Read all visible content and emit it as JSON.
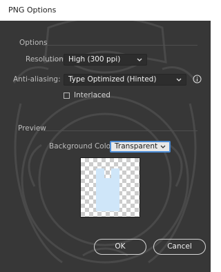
{
  "window": {
    "title": "PNG Options"
  },
  "options": {
    "group_label": "Options",
    "resolution": {
      "label": "Resolution:",
      "value": "High (300 ppi)"
    },
    "anti_aliasing": {
      "label": "Anti-aliasing:",
      "value": "Type Optimized (Hinted)"
    },
    "interlaced": {
      "label": "Interlaced",
      "checked": false
    }
  },
  "preview": {
    "group_label": "Preview",
    "background_color": {
      "label": "Background Color:",
      "value": "Transparent"
    }
  },
  "buttons": {
    "ok": "OK",
    "cancel": "Cancel"
  },
  "colors": {
    "dialog_bg": "#373737",
    "text": "#bdbdbd",
    "accent": "#4a8ad4",
    "preview_shape": "#cfe6f9"
  },
  "icons": [
    "chevron-down-icon",
    "info-icon",
    "checkbox",
    "seal-watermark"
  ]
}
